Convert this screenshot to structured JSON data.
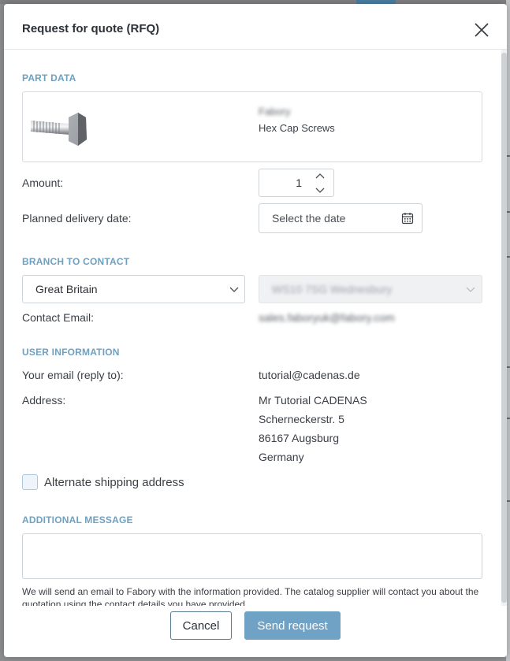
{
  "dialog": {
    "title": "Request for quote (RFQ)"
  },
  "part_data": {
    "section_title": "PART DATA",
    "supplier": "Fabory",
    "product": "Hex Cap Screws"
  },
  "amount": {
    "label": "Amount:",
    "value": "1"
  },
  "delivery": {
    "label": "Planned delivery date:",
    "placeholder": "Select the date"
  },
  "branch": {
    "section_title": "BRANCH TO CONTACT",
    "country": "Great Britain",
    "location": "WS10 7SG Wednesbury",
    "email_label": "Contact Email:",
    "email": "sales.faboryuk@fabory.com"
  },
  "user_info": {
    "section_title": "USER INFORMATION",
    "email_label": "Your email (reply to):",
    "email": "tutorial@cadenas.de",
    "address_label": "Address:",
    "address_lines": [
      "Mr Tutorial CADENAS",
      "Scherneckerstr. 5",
      "86167 Augsburg",
      "Germany"
    ],
    "alt_shipping_label": "Alternate shipping address"
  },
  "message": {
    "section_title": "ADDITIONAL MESSAGE",
    "notice": "We will send an email to Fabory with the information provided. The catalog supplier will contact you about the quotation using the contact details you have provided."
  },
  "footer": {
    "cancel_label": "Cancel",
    "send_label": "Send request"
  },
  "colors": {
    "accent": "#6fa2c4",
    "section_title": "#6fa0c0",
    "border": "#ced3d8"
  }
}
